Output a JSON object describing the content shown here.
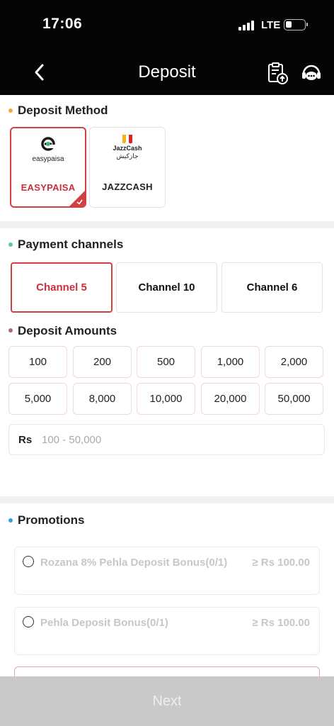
{
  "status": {
    "time": "17:06",
    "network": "LTE"
  },
  "header": {
    "title": "Deposit",
    "back_icon": "chevron-left-icon",
    "history_icon": "clipboard-upload-icon",
    "support_icon": "headset-chat-icon"
  },
  "deposit_method": {
    "title": "Deposit Method",
    "dot_color": "#f2a93b",
    "methods": [
      {
        "label": "EASYPAISA",
        "logo_text": "easypaisa",
        "selected": true,
        "label_color": "#c8303a"
      },
      {
        "label": "JAZZCASH",
        "logo_text": "JazzCash",
        "logo_urdu": "جازکیش",
        "selected": false,
        "label_color": "#222222"
      }
    ]
  },
  "payment_channels": {
    "title": "Payment channels",
    "dot_color": "#5cc3b5",
    "channels": [
      {
        "label": "Channel 5",
        "selected": true
      },
      {
        "label": "Channel 10",
        "selected": false
      },
      {
        "label": "Channel 6",
        "selected": false
      }
    ]
  },
  "deposit_amounts": {
    "title": "Deposit Amounts",
    "dot_color": "#a8687c",
    "amounts": [
      "100",
      "200",
      "500",
      "1,000",
      "2,000",
      "5,000",
      "8,000",
      "10,000",
      "20,000",
      "50,000"
    ],
    "currency_label": "Rs",
    "input_placeholder": "100 - 50,000",
    "input_value": ""
  },
  "promotions": {
    "title": "Promotions",
    "dot_color": "#2aa3d8",
    "items": [
      {
        "name": "Rozana 8% Pehla Deposit Bonus(0/1)",
        "amount": "≥ Rs 100.00"
      },
      {
        "name": "Pehla Deposit Bonus(0/1)",
        "amount": "≥ Rs 100.00"
      }
    ]
  },
  "footer": {
    "next_label": "Next"
  },
  "colors": {
    "accent": "#d04040",
    "header_bg": "#050505",
    "disabled_button": "#c9c9c9"
  }
}
